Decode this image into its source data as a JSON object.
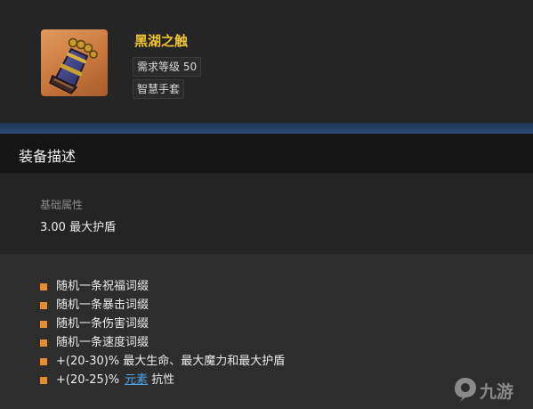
{
  "item": {
    "name": "黑湖之触",
    "level_requirement": "需求等级 50",
    "type": "智慧手套",
    "icon": "gauntlet-icon",
    "icon_bg_color": "#d3864a",
    "name_color": "#f1c232"
  },
  "section": {
    "title": "装备描述"
  },
  "base_attributes": {
    "label": "基础属性",
    "value": "3.00 最大护盾"
  },
  "affixes": [
    {
      "text": "随机一条祝福词缀"
    },
    {
      "text": "随机一条暴击词缀"
    },
    {
      "text": "随机一条伤害词缀"
    },
    {
      "text": "随机一条速度词缀"
    },
    {
      "text": "+(20-30)% 最大生命、最大魔力和最大护盾"
    },
    {
      "prefix": "+(20-25)%",
      "link": "元素",
      "suffix": "抗性"
    }
  ],
  "colors": {
    "bullet": "#e98c2e",
    "link": "#4da3e8"
  },
  "watermark": {
    "text": "九游",
    "icon": "jiuyou-logo-icon"
  }
}
